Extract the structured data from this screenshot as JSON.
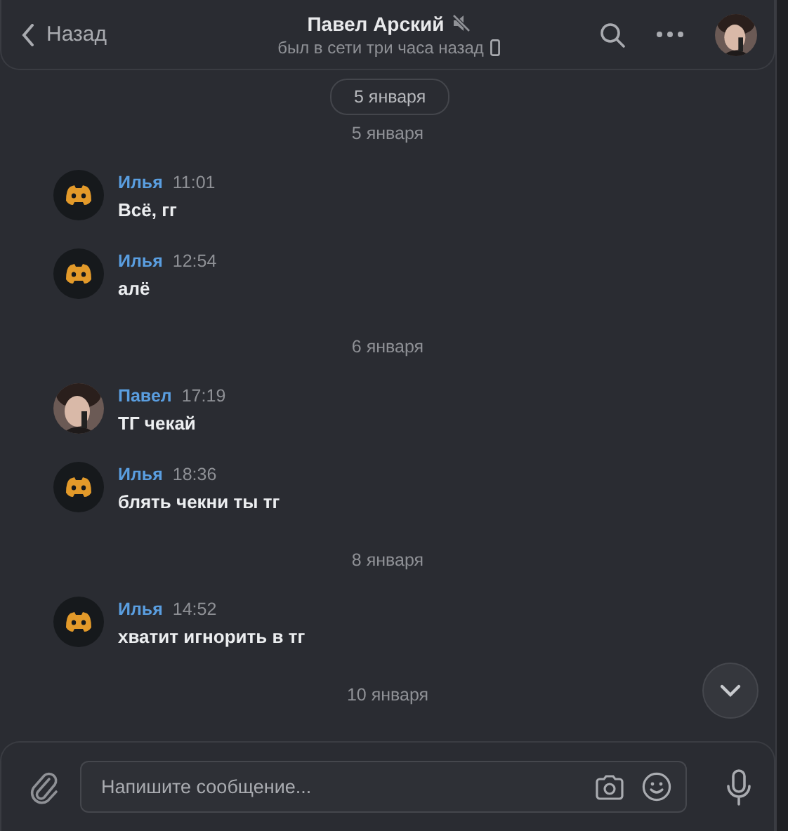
{
  "header": {
    "back": "Назад",
    "title": "Павел Арский",
    "muted": true,
    "status": "был в сети три часа назад"
  },
  "floating_date": "5 января",
  "feed": [
    {
      "kind": "date",
      "text": "5 января"
    },
    {
      "kind": "message",
      "avatar": {
        "kind": "logo"
      },
      "author": "Илья",
      "time": "11:01",
      "text": "Всё, гг"
    },
    {
      "kind": "message",
      "avatar": {
        "kind": "logo"
      },
      "author": "Илья",
      "time": "12:54",
      "text": "алё"
    },
    {
      "kind": "date",
      "text": "6 января"
    },
    {
      "kind": "message",
      "author": "Павел",
      "time": "17:19",
      "text": "ТГ чекай"
    },
    {
      "kind": "message",
      "avatar": {
        "kind": "logo"
      },
      "author": "Илья",
      "time": "18:36",
      "text": "блять чекни ты тг"
    },
    {
      "kind": "date",
      "text": "8 января"
    },
    {
      "kind": "message",
      "avatar": {
        "kind": "logo"
      },
      "author": "Илья",
      "time": "14:52",
      "text": "хватит игнорить в тг"
    },
    {
      "kind": "date",
      "text": "10 января"
    }
  ],
  "composer": {
    "placeholder": "Напишите сообщение..."
  }
}
